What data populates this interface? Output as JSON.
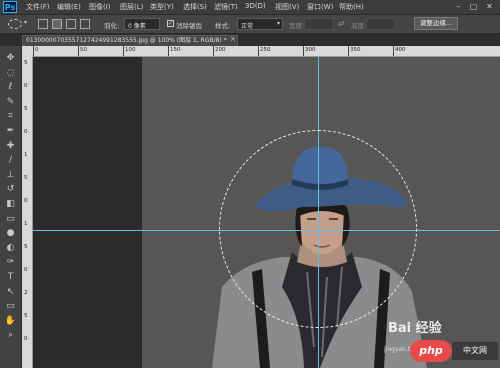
{
  "app": {
    "logo": "Ps"
  },
  "menu": [
    "文件(F)",
    "编辑(E)",
    "图像(I)",
    "图层(L)",
    "类型(Y)",
    "选择(S)",
    "滤镜(T)",
    "3D(D)",
    "视图(V)",
    "窗口(W)",
    "帮助(H)"
  ],
  "window_controls": {
    "minimize": "–",
    "maximize": "▢",
    "close": "✕"
  },
  "options": {
    "feather_label": "羽化:",
    "feather_value": "0 像素",
    "antialias_label": "消除锯齿",
    "style_label": "样式:",
    "style_value": "正常",
    "width_label": "宽度:",
    "height_label": "高度:",
    "refine_edge": "调整边缘..."
  },
  "document": {
    "tab_title": "01300000703557127424991283555.jpg @ 100% (图层 1, RGB/8) *",
    "close": "×"
  },
  "ruler": {
    "top_labels": [
      "0",
      "50",
      "100",
      "150",
      "200",
      "250",
      "300",
      "350",
      "400"
    ],
    "left_labels": [
      "5",
      "0",
      "5",
      "0",
      "1",
      "5",
      "0",
      "1",
      "5",
      "0",
      "2",
      "5",
      "0"
    ]
  },
  "tools": [
    "move-tool",
    "marquee-tool",
    "lasso-tool",
    "quick-select-tool",
    "crop-tool",
    "eyedropper-tool",
    "healing-tool",
    "brush-tool",
    "stamp-tool",
    "history-brush-tool",
    "eraser-tool",
    "gradient-tool",
    "blur-tool",
    "dodge-tool",
    "pen-tool",
    "type-tool",
    "path-select-tool",
    "shape-tool",
    "hand-tool",
    "zoom-tool"
  ],
  "tool_glyphs": [
    "✥",
    "◌",
    "ℓ",
    "✎",
    "⌗",
    "✒",
    "✚",
    "∕",
    "⊥",
    "↺",
    "◧",
    "▭",
    "●",
    "◐",
    "✑",
    "T",
    "↖",
    "▭",
    "✋",
    "⌕"
  ],
  "watermark": {
    "text": "Bai 经验",
    "url": "jingyan.baidu.com",
    "badge": "php",
    "badge2": "中文网"
  },
  "colors": {
    "guide": "#5fc1ea",
    "canvas": "#575655",
    "dark_area": "#2a2a2a"
  }
}
